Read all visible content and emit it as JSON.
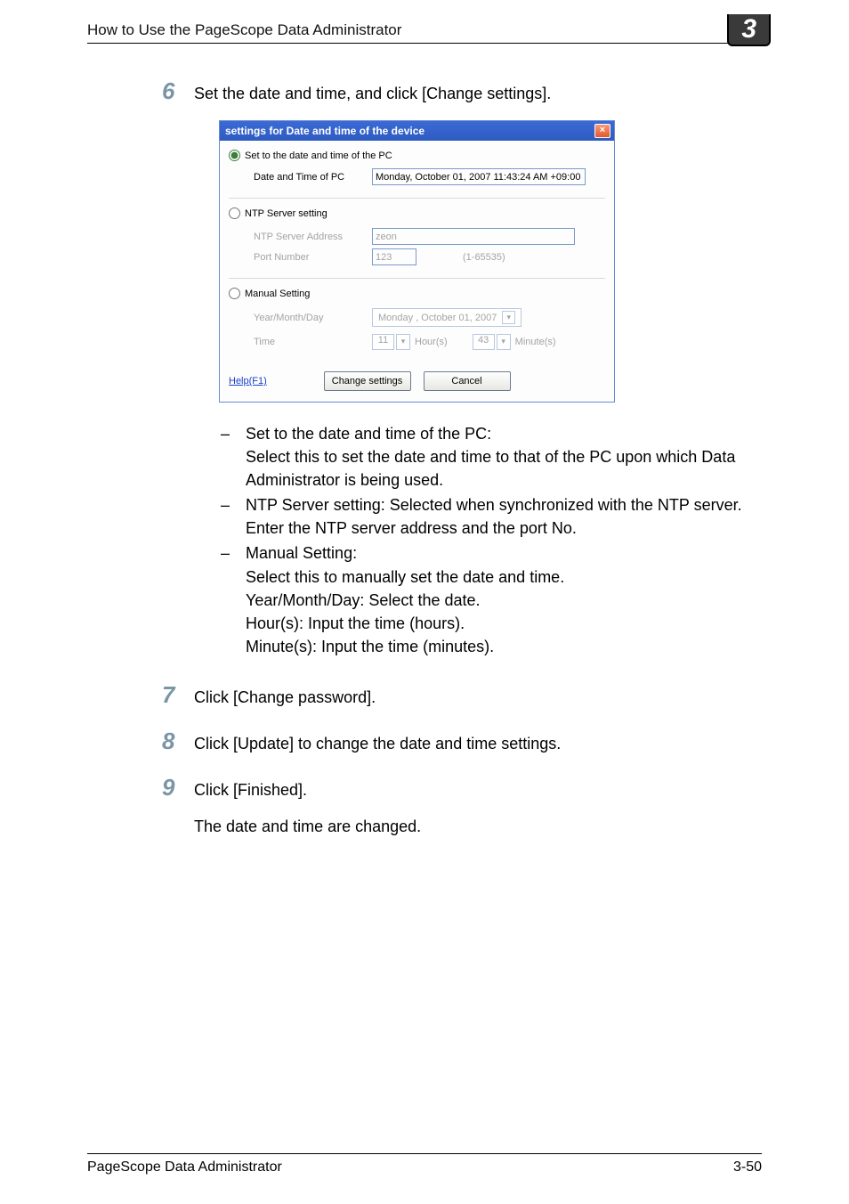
{
  "header": {
    "title": "How to Use the PageScope Data Administrator",
    "chapter": "3"
  },
  "steps": {
    "six": {
      "num": "6",
      "text": "Set the date and time, and click [Change settings]."
    },
    "seven": {
      "num": "7",
      "text": "Click [Change password]."
    },
    "eight": {
      "num": "8",
      "text": "Click [Update] to change the date and time settings."
    },
    "nine": {
      "num": "9",
      "text": "Click [Finished]."
    },
    "nine_after": "The date and time are changed."
  },
  "dialog": {
    "title": "settings for Date and time of the device",
    "close": "×",
    "opt1": {
      "label": "Set to the date and time of the PC",
      "field": "Date and Time of PC",
      "value": "Monday, October 01, 2007 11:43:24 AM +09:00"
    },
    "opt2": {
      "label": "NTP Server setting",
      "addr_label": "NTP Server Address",
      "addr_val": "zeon",
      "port_label": "Port Number",
      "port_val": "123",
      "port_range": "(1-65535)"
    },
    "opt3": {
      "label": "Manual Setting",
      "date_label": "Year/Month/Day",
      "date_val": "Monday   ,  October   01, 2007",
      "time_label": "Time",
      "hour": "11",
      "hour_unit": "Hour(s)",
      "minute": "43",
      "minute_unit": "Minute(s)"
    },
    "help": "Help(F1)",
    "change": "Change settings",
    "cancel": "Cancel"
  },
  "bullets": {
    "b1_head": "Set to the date and time of the PC:",
    "b1_body": "Select this to set the date and time to that of the PC upon which Data Administrator is being used.",
    "b2": "NTP Server setting: Selected when synchronized with the NTP server. Enter the NTP server address and the port No.",
    "b3_head": "Manual Setting:",
    "b3_l1": "Select this to manually set the date and time.",
    "b3_l2": "Year/Month/Day: Select the date.",
    "b3_l3": "Hour(s): Input the time (hours).",
    "b3_l4": "Minute(s): Input the time (minutes)."
  },
  "footer": {
    "left": "PageScope Data Administrator",
    "right": "3-50"
  }
}
